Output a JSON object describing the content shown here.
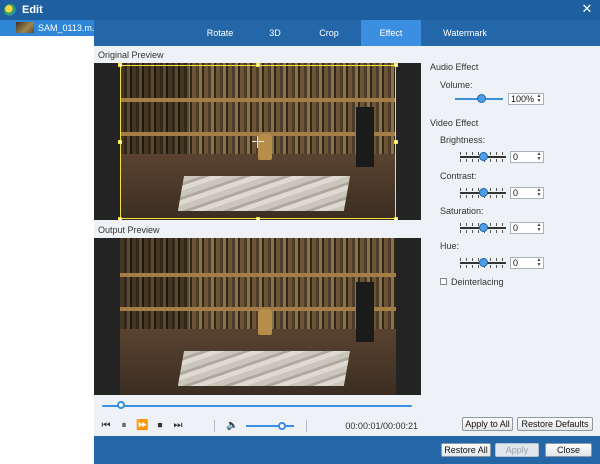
{
  "window": {
    "title": "Edit",
    "close_glyph": "✕"
  },
  "file_list": {
    "items": [
      {
        "name": "SAM_0113.m..."
      }
    ]
  },
  "tabs": [
    {
      "label": "Rotate",
      "active": false
    },
    {
      "label": "3D",
      "active": false
    },
    {
      "label": "Crop",
      "active": false
    },
    {
      "label": "Effect",
      "active": true
    },
    {
      "label": "Watermark",
      "active": false
    }
  ],
  "preview": {
    "original_label": "Original Preview",
    "output_label": "Output Preview",
    "progress_fraction": 0.06,
    "timecode": "00:00:01/00:00:21",
    "volume_fraction": 0.75
  },
  "effects": {
    "audio_group": "Audio Effect",
    "volume": {
      "label": "Volume:",
      "value": "100%",
      "fraction": 0.55
    },
    "video_group": "Video Effect",
    "brightness": {
      "label": "Brightness:",
      "value": "0",
      "fraction": 0.5
    },
    "contrast": {
      "label": "Contrast:",
      "value": "0",
      "fraction": 0.5
    },
    "saturation": {
      "label": "Saturation:",
      "value": "0",
      "fraction": 0.5
    },
    "hue": {
      "label": "Hue:",
      "value": "0",
      "fraction": 0.5
    },
    "deinterlacing": {
      "label": "Deinterlacing",
      "checked": false
    }
  },
  "buttons": {
    "apply_to_all": "Apply to All",
    "restore_defaults": "Restore Defaults",
    "restore_all": "Restore All",
    "apply": "Apply",
    "close": "Close"
  },
  "colors": {
    "accent": "#3b8fe0",
    "titlebar": "#1d5f9f",
    "crop_frame": "#f2e23a"
  }
}
